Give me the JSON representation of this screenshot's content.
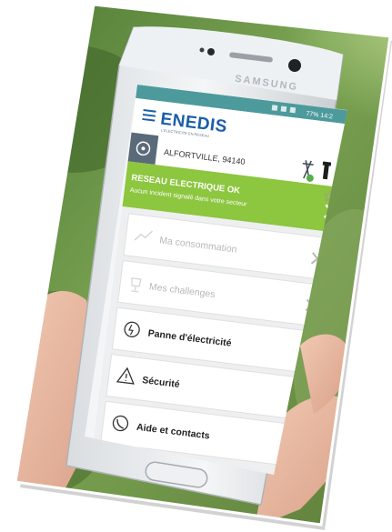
{
  "phone": {
    "brand": "SAMSUNG",
    "status_bar": "77% 14:2"
  },
  "app": {
    "logo_text": "ENEDIS",
    "logo_tagline": "L'ELECTRICITE EN RESEAU",
    "location": "ALFORTVILLE, 94140",
    "status_title": "RESEAU ELECTRIQUE OK",
    "status_subtitle": "Aucun incident signalé dans votre secteur",
    "colors": {
      "enedis_blue": "#1a5ea8",
      "status_green": "#8dc63f",
      "gray_bar": "#c8c9cb"
    }
  },
  "menu": {
    "items": [
      {
        "label": "Ma consommation",
        "icon": "chart-line-icon",
        "enabled": false
      },
      {
        "label": "Mes challenges",
        "icon": "trophy-icon",
        "enabled": false
      },
      {
        "label": "Panne d'électricité",
        "icon": "power-outage-icon",
        "enabled": true
      },
      {
        "label": "Sécurité",
        "icon": "warning-triangle-icon",
        "enabled": true
      },
      {
        "label": "Aide et contacts",
        "icon": "phone-icon",
        "enabled": true
      }
    ]
  }
}
